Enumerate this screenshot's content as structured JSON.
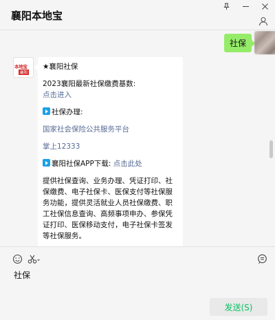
{
  "window": {
    "title": "襄阳本地宝"
  },
  "chat": {
    "sent_message": "社保",
    "reply": {
      "avatar_logo_text": "本地宝",
      "avatar_logo_badge": "襄阳",
      "header": "★襄阳社保",
      "base_title": "2023襄阳最新社保缴费基数:",
      "base_link": "点击进入",
      "service_heading": "社保办理:",
      "service_link_1": "国家社会保险公共服务平台",
      "service_link_2": "掌上12333",
      "app_label": "襄阳社保APP下载:",
      "app_link": "点击此处",
      "description": "提供社保查询、业务办理、凭证打印、社保缴费、电子社保卡、医保支付等社保服务功能，提供灵活就业人员社保缴费、职工社保信息查询、高频事项申办、参保凭证打印、医保移动支付，电子社保卡签发等社保服务。"
    }
  },
  "input": {
    "value": "社保",
    "send_label": "发送(S)"
  },
  "colors": {
    "accent_green": "#07c160",
    "bubble_green": "#95ec69",
    "link_blue": "#576b95"
  },
  "icons": [
    "pin-icon",
    "minimize-icon",
    "close-icon",
    "person-icon",
    "emoji-icon",
    "scissors-icon",
    "chat-history-icon"
  ]
}
